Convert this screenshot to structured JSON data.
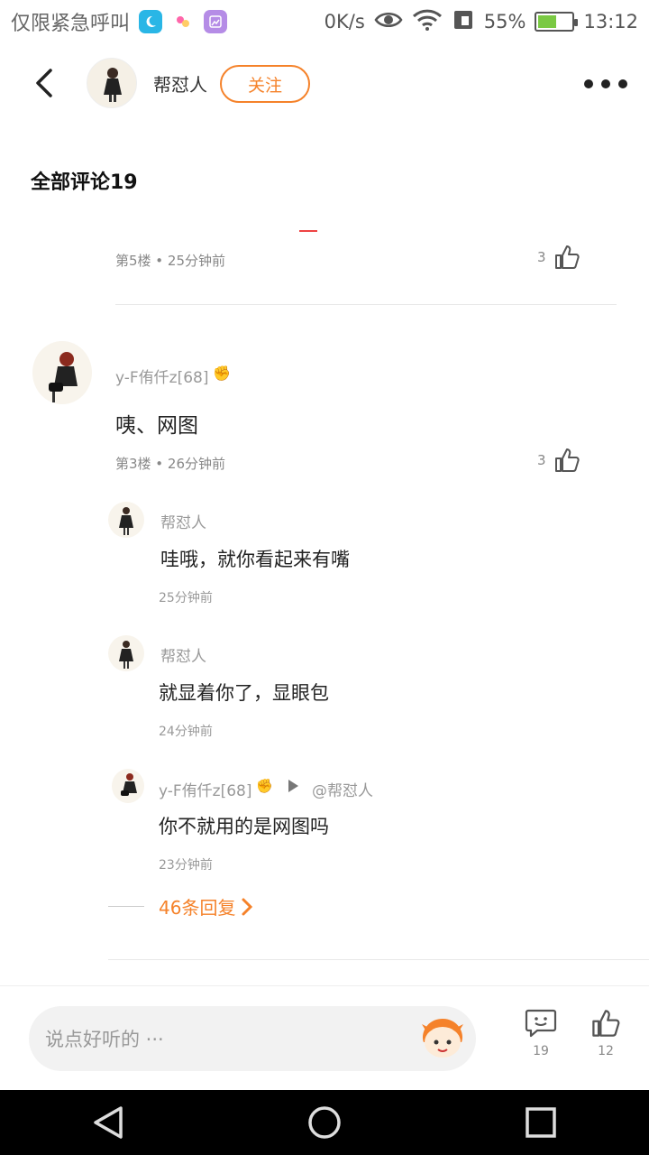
{
  "statusbar": {
    "left_text": "仅限紧急呼叫",
    "net_speed": "0K/s",
    "battery_pct": "55%",
    "time": "13:12",
    "battery_level": 0.55
  },
  "header": {
    "name": "帮怼人",
    "follow_label": "关注"
  },
  "section_title": "全部评论19",
  "comments": [
    {
      "floor_meta": "第5楼 • 25分钟前",
      "likes": "3"
    },
    {
      "username": "y-F侑仟z[68]",
      "text": "咦、网图",
      "floor_meta": "第3楼 • 26分钟前",
      "likes": "3",
      "replies": [
        {
          "username": "帮怼人",
          "text": "哇哦，就你看起来有嘴",
          "time": "25分钟前"
        },
        {
          "username": "帮怼人",
          "text": "就显着你了，显眼包",
          "time": "24分钟前"
        },
        {
          "username": "y-F侑仟z[68]",
          "reply_to": "@帮怼人",
          "text": "你不就用的是网图吗",
          "time": "23分钟前"
        }
      ],
      "more_replies": "46条回复"
    }
  ],
  "bottom": {
    "placeholder": "说点好听的 ···",
    "comment_count": "19",
    "like_count": "12"
  },
  "colors": {
    "accent": "#f5822a"
  },
  "icons": [
    "back-arrow-icon",
    "more-dots-icon",
    "thumb-up-icon",
    "comment-icon",
    "nav-back-icon",
    "nav-home-icon",
    "nav-recent-icon"
  ]
}
